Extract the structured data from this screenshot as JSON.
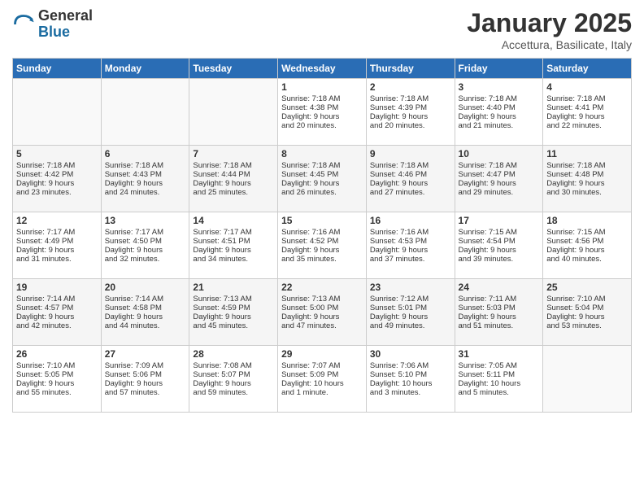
{
  "logo": {
    "general": "General",
    "blue": "Blue"
  },
  "title": "January 2025",
  "subtitle": "Accettura, Basilicate, Italy",
  "days_of_week": [
    "Sunday",
    "Monday",
    "Tuesday",
    "Wednesday",
    "Thursday",
    "Friday",
    "Saturday"
  ],
  "weeks": [
    [
      {
        "day": "",
        "info": ""
      },
      {
        "day": "",
        "info": ""
      },
      {
        "day": "",
        "info": ""
      },
      {
        "day": "1",
        "info": "Sunrise: 7:18 AM\nSunset: 4:38 PM\nDaylight: 9 hours\nand 20 minutes."
      },
      {
        "day": "2",
        "info": "Sunrise: 7:18 AM\nSunset: 4:39 PM\nDaylight: 9 hours\nand 20 minutes."
      },
      {
        "day": "3",
        "info": "Sunrise: 7:18 AM\nSunset: 4:40 PM\nDaylight: 9 hours\nand 21 minutes."
      },
      {
        "day": "4",
        "info": "Sunrise: 7:18 AM\nSunset: 4:41 PM\nDaylight: 9 hours\nand 22 minutes."
      }
    ],
    [
      {
        "day": "5",
        "info": "Sunrise: 7:18 AM\nSunset: 4:42 PM\nDaylight: 9 hours\nand 23 minutes."
      },
      {
        "day": "6",
        "info": "Sunrise: 7:18 AM\nSunset: 4:43 PM\nDaylight: 9 hours\nand 24 minutes."
      },
      {
        "day": "7",
        "info": "Sunrise: 7:18 AM\nSunset: 4:44 PM\nDaylight: 9 hours\nand 25 minutes."
      },
      {
        "day": "8",
        "info": "Sunrise: 7:18 AM\nSunset: 4:45 PM\nDaylight: 9 hours\nand 26 minutes."
      },
      {
        "day": "9",
        "info": "Sunrise: 7:18 AM\nSunset: 4:46 PM\nDaylight: 9 hours\nand 27 minutes."
      },
      {
        "day": "10",
        "info": "Sunrise: 7:18 AM\nSunset: 4:47 PM\nDaylight: 9 hours\nand 29 minutes."
      },
      {
        "day": "11",
        "info": "Sunrise: 7:18 AM\nSunset: 4:48 PM\nDaylight: 9 hours\nand 30 minutes."
      }
    ],
    [
      {
        "day": "12",
        "info": "Sunrise: 7:17 AM\nSunset: 4:49 PM\nDaylight: 9 hours\nand 31 minutes."
      },
      {
        "day": "13",
        "info": "Sunrise: 7:17 AM\nSunset: 4:50 PM\nDaylight: 9 hours\nand 32 minutes."
      },
      {
        "day": "14",
        "info": "Sunrise: 7:17 AM\nSunset: 4:51 PM\nDaylight: 9 hours\nand 34 minutes."
      },
      {
        "day": "15",
        "info": "Sunrise: 7:16 AM\nSunset: 4:52 PM\nDaylight: 9 hours\nand 35 minutes."
      },
      {
        "day": "16",
        "info": "Sunrise: 7:16 AM\nSunset: 4:53 PM\nDaylight: 9 hours\nand 37 minutes."
      },
      {
        "day": "17",
        "info": "Sunrise: 7:15 AM\nSunset: 4:54 PM\nDaylight: 9 hours\nand 39 minutes."
      },
      {
        "day": "18",
        "info": "Sunrise: 7:15 AM\nSunset: 4:56 PM\nDaylight: 9 hours\nand 40 minutes."
      }
    ],
    [
      {
        "day": "19",
        "info": "Sunrise: 7:14 AM\nSunset: 4:57 PM\nDaylight: 9 hours\nand 42 minutes."
      },
      {
        "day": "20",
        "info": "Sunrise: 7:14 AM\nSunset: 4:58 PM\nDaylight: 9 hours\nand 44 minutes."
      },
      {
        "day": "21",
        "info": "Sunrise: 7:13 AM\nSunset: 4:59 PM\nDaylight: 9 hours\nand 45 minutes."
      },
      {
        "day": "22",
        "info": "Sunrise: 7:13 AM\nSunset: 5:00 PM\nDaylight: 9 hours\nand 47 minutes."
      },
      {
        "day": "23",
        "info": "Sunrise: 7:12 AM\nSunset: 5:01 PM\nDaylight: 9 hours\nand 49 minutes."
      },
      {
        "day": "24",
        "info": "Sunrise: 7:11 AM\nSunset: 5:03 PM\nDaylight: 9 hours\nand 51 minutes."
      },
      {
        "day": "25",
        "info": "Sunrise: 7:10 AM\nSunset: 5:04 PM\nDaylight: 9 hours\nand 53 minutes."
      }
    ],
    [
      {
        "day": "26",
        "info": "Sunrise: 7:10 AM\nSunset: 5:05 PM\nDaylight: 9 hours\nand 55 minutes."
      },
      {
        "day": "27",
        "info": "Sunrise: 7:09 AM\nSunset: 5:06 PM\nDaylight: 9 hours\nand 57 minutes."
      },
      {
        "day": "28",
        "info": "Sunrise: 7:08 AM\nSunset: 5:07 PM\nDaylight: 9 hours\nand 59 minutes."
      },
      {
        "day": "29",
        "info": "Sunrise: 7:07 AM\nSunset: 5:09 PM\nDaylight: 10 hours\nand 1 minute."
      },
      {
        "day": "30",
        "info": "Sunrise: 7:06 AM\nSunset: 5:10 PM\nDaylight: 10 hours\nand 3 minutes."
      },
      {
        "day": "31",
        "info": "Sunrise: 7:05 AM\nSunset: 5:11 PM\nDaylight: 10 hours\nand 5 minutes."
      },
      {
        "day": "",
        "info": ""
      }
    ]
  ]
}
